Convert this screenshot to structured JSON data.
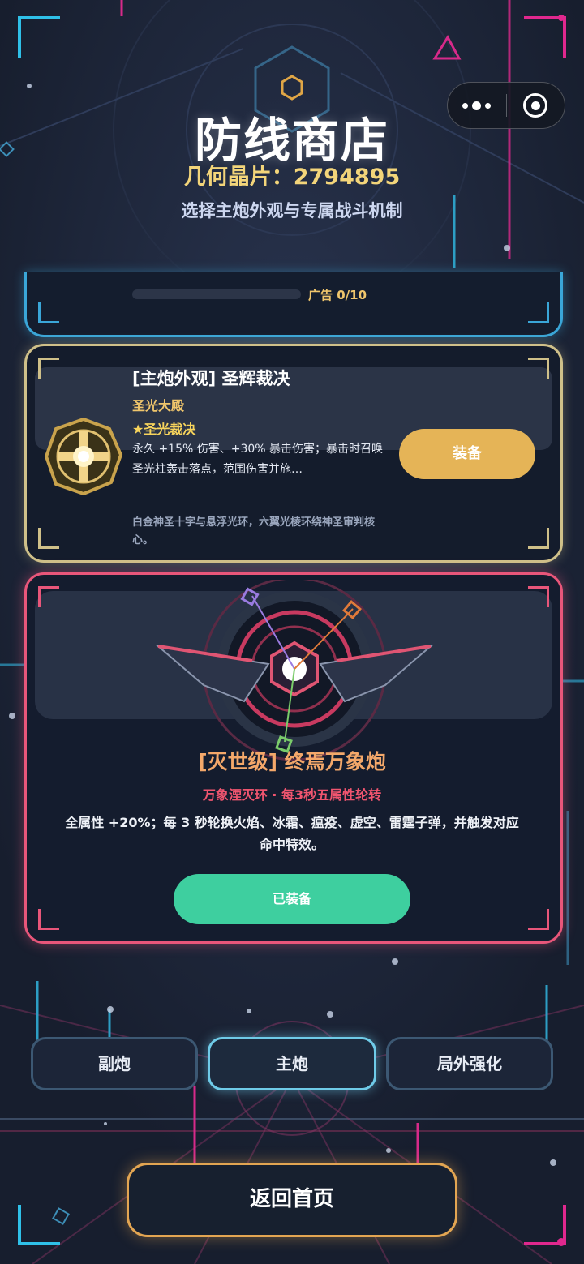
{
  "header": {
    "title": "防线商店",
    "currency_label": "几何晶片：2794895",
    "subtitle": "选择主炮外观与专属战斗机制"
  },
  "capsule": {
    "more_icon": "more-dots-icon",
    "close_icon": "target-circle-icon"
  },
  "ad_card": {
    "progress_text": "广告 0/10",
    "progress": 0.0
  },
  "skin_card": {
    "title": "[主炮外观] 圣辉裁决",
    "subtitle": "圣光大殿",
    "skill": "★圣光裁决",
    "description": "永久 +15% 伤害、+30% 暴击伤害；暴击时召唤圣光柱轰击落点，范围伤害并施…",
    "flavor": "白金神圣十字与悬浮光环，六翼光棱环绕神圣审判核心。",
    "button_label": "装备",
    "icon": "holy-cross-emblem-icon",
    "accent": "#e5b457"
  },
  "featured_card": {
    "title": "[灭世级] 终焉万象炮",
    "subtitle": "万象湮灭环 · 每3秒五属性轮转",
    "description": "全属性 +20%；每 3 秒轮换火焰、冰霜、瘟疫、虚空、雷霆子弹，并触发对应命中特效。",
    "button_label": "已装备",
    "icon": "cannon-turret-icon",
    "accent": "#e8567a",
    "button_color": "#3ecf9f"
  },
  "tabs": [
    {
      "label": "副炮",
      "active": false
    },
    {
      "label": "主炮",
      "active": true
    },
    {
      "label": "局外强化",
      "active": false
    }
  ],
  "home_button": {
    "label": "返回首页"
  }
}
